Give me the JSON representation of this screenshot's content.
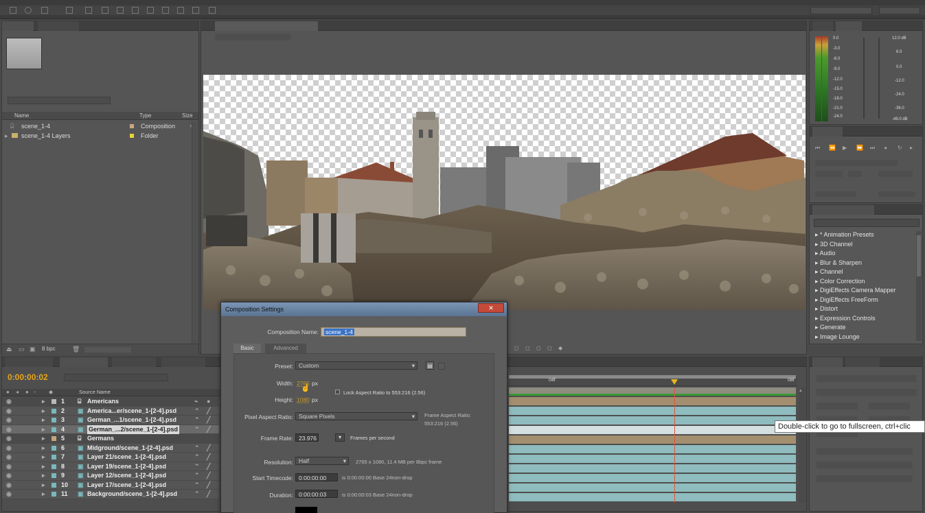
{
  "project": {
    "columns": {
      "name": "Name",
      "type": "Type",
      "size": "Size"
    },
    "items": [
      {
        "name": "scene_1-4",
        "type": "Composition"
      },
      {
        "name": "scene_1-4 Layers",
        "type": "Folder"
      }
    ],
    "bpc": "8 bpc"
  },
  "timeline": {
    "timecode": "0:00:00:02",
    "ruler": {
      "mark1": "04f",
      "mark2": "08f"
    },
    "layer_header": "Source Name",
    "layers": [
      {
        "num": "1",
        "name": "Americans"
      },
      {
        "num": "2",
        "name": "America...er/scene_1-[2-4].psd"
      },
      {
        "num": "3",
        "name": "German_...1/scene_1-[2-4].psd"
      },
      {
        "num": "4",
        "name": "German_...2/scene_1-[2-4].psd"
      },
      {
        "num": "5",
        "name": "Germans"
      },
      {
        "num": "6",
        "name": "Midground/scene_1-[2-4].psd"
      },
      {
        "num": "7",
        "name": "Layer 21/scene_1-[2-4].psd"
      },
      {
        "num": "8",
        "name": "Layer 19/scene_1-[2-4].psd"
      },
      {
        "num": "9",
        "name": "Layer 12/scene_1-[2-4].psd"
      },
      {
        "num": "10",
        "name": "Layer 17/scene_1-[2-4].psd"
      },
      {
        "num": "11",
        "name": "Background/scene_1-[2-4].psd"
      }
    ]
  },
  "audio": {
    "left_scale": [
      "0.0",
      "-3.0",
      "-6.0",
      "-9.0",
      "-12.0",
      "-15.0",
      "-18.0",
      "-21.0",
      "-24.0"
    ],
    "right_scale": [
      "12.0 dB",
      "6.0",
      "0.0",
      "-12.0",
      "-24.0",
      "-36.0",
      "-48.0 dB"
    ]
  },
  "effects": {
    "items": [
      "* Animation Presets",
      "3D Channel",
      "Audio",
      "Blur & Sharpen",
      "Channel",
      "Color Correction",
      "DigiEffects Camera Mapper",
      "DigiEffects FreeForm",
      "Distort",
      "Expression Controls",
      "Generate",
      "Image Lounge"
    ]
  },
  "dialog": {
    "title": "Composition Settings",
    "comp_name_label": "Composition Name:",
    "comp_name_value": "scene_1-4",
    "tabs": {
      "basic": "Basic",
      "advanced": "Advanced"
    },
    "preset_label": "Preset:",
    "preset_value": "Custom",
    "width_label": "Width:",
    "width_value": "2765",
    "height_label": "Height:",
    "height_value": "1080",
    "px": "px",
    "lock_label": "Lock Aspect Ratio to 553:216 (2.56)",
    "par_label": "Pixel Aspect Ratio:",
    "par_value": "Square Pixels",
    "far_label": "Frame Aspect Ratio:",
    "far_value": "553:216 (2.56)",
    "frame_rate_label": "Frame Rate:",
    "frame_rate_value": "23.976",
    "fps_label": "Frames per second",
    "resolution_label": "Resolution:",
    "resolution_value": "Half",
    "resolution_note": "2765 x 1080, 11.4 MB per 8bpc frame",
    "start_tc_label": "Start Timecode:",
    "start_tc_value": "0:00:00:00",
    "start_tc_note": "is 0:00:00:00  Base 24non-drop",
    "duration_label": "Duration:",
    "duration_value": "0:00:00:03",
    "duration_note": "is 0:00:00:03  Base 24non-drop"
  },
  "tooltip": "Double-click to go to fullscreen, ctrl+clic"
}
